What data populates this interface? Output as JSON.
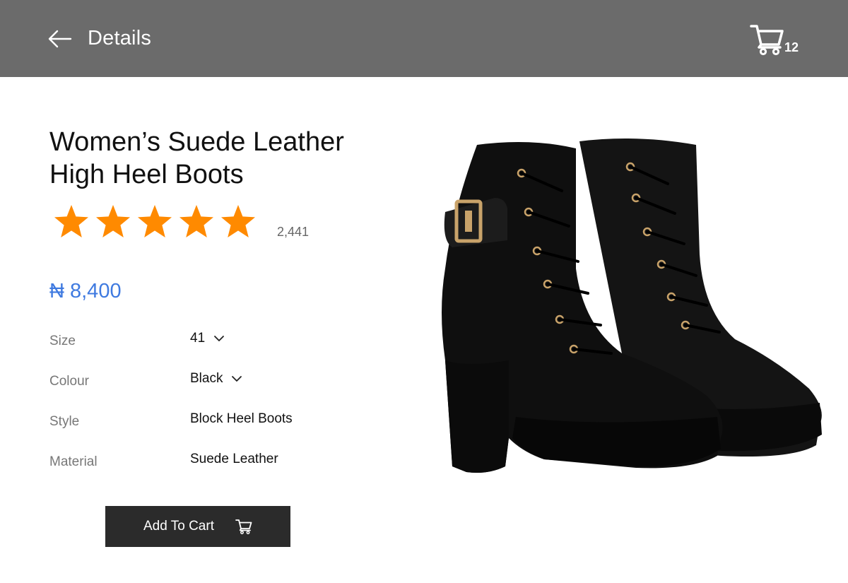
{
  "header": {
    "title": "Details",
    "cart_count": "12",
    "back_icon": "arrow-left-icon",
    "cart_icon": "shopping-cart-icon",
    "background_color": "#6b6b6b"
  },
  "product": {
    "title": "Women’s Suede Leather High Heel Boots",
    "rating": 5,
    "rating_max": 5,
    "rating_count": "2,441",
    "star_color": "#ff8a00",
    "price": "₦ 8,400",
    "price_color": "#3f7ae0",
    "image_icon": "boots-image"
  },
  "specs": [
    {
      "label": "Size",
      "value": "41",
      "selectable": true
    },
    {
      "label": "Colour",
      "value": "Black",
      "selectable": true
    },
    {
      "label": "Style",
      "value": "Block Heel Boots",
      "selectable": false
    },
    {
      "label": "Material",
      "value": "Suede Leather",
      "selectable": false
    }
  ],
  "actions": {
    "add_to_cart_label": "Add To Cart",
    "button_color": "#2b2b2b"
  }
}
